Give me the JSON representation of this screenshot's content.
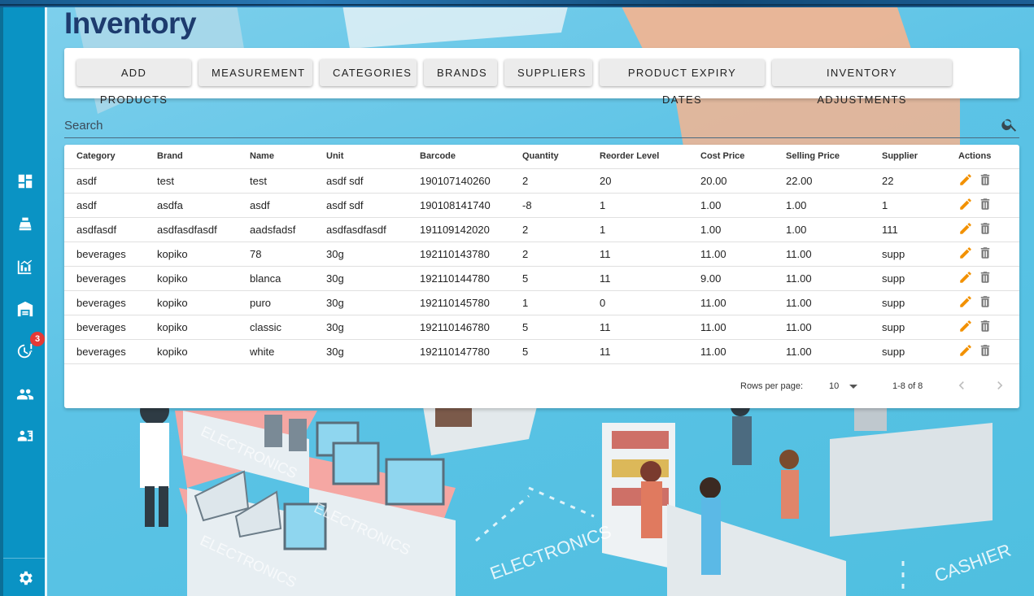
{
  "app": {
    "title": "Inventory"
  },
  "sidebar": {
    "items": [
      {
        "icon": "dashboard-icon"
      },
      {
        "icon": "cash-register-icon"
      },
      {
        "icon": "analytics-icon"
      },
      {
        "icon": "warehouse-icon"
      },
      {
        "icon": "clock-alert-icon",
        "badge": "3"
      },
      {
        "icon": "people-icon"
      },
      {
        "icon": "account-box-icon"
      }
    ],
    "footer_icon": "gear-icon"
  },
  "toolbar": {
    "buttons": [
      "ADD PRODUCTS",
      "MEASUREMENT",
      "CATEGORIES",
      "BRANDS",
      "SUPPLIERS",
      "PRODUCT EXPIRY DATES",
      "INVENTORY ADJUSTMENTS"
    ]
  },
  "search": {
    "placeholder": "Search",
    "value": ""
  },
  "table": {
    "columns": [
      "Category",
      "Brand",
      "Name",
      "Unit",
      "Barcode",
      "Quantity",
      "Reorder Level",
      "Cost Price",
      "Selling Price",
      "Supplier",
      "Actions"
    ],
    "rows": [
      [
        "asdf",
        "test",
        "test",
        "asdf sdf",
        "190107140260",
        "2",
        "20",
        "20.00",
        "22.00",
        "22"
      ],
      [
        "asdf",
        "asdfa",
        "asdf",
        "asdf sdf",
        "190108141740",
        "-8",
        "1",
        "1.00",
        "1.00",
        "1"
      ],
      [
        "asdfasdf",
        "asdfasdfasdf",
        "aadsfadsf",
        "asdfasdfasdf",
        "191109142020",
        "2",
        "1",
        "1.00",
        "1.00",
        "111"
      ],
      [
        "beverages",
        "kopiko",
        "78",
        "30g",
        "192110143780",
        "2",
        "11",
        "11.00",
        "11.00",
        "supp"
      ],
      [
        "beverages",
        "kopiko",
        "blanca",
        "30g",
        "192110144780",
        "5",
        "11",
        "9.00",
        "11.00",
        "supp"
      ],
      [
        "beverages",
        "kopiko",
        "puro",
        "30g",
        "192110145780",
        "1",
        "0",
        "11.00",
        "11.00",
        "supp"
      ],
      [
        "beverages",
        "kopiko",
        "classic",
        "30g",
        "192110146780",
        "5",
        "11",
        "11.00",
        "11.00",
        "supp"
      ],
      [
        "beverages",
        "kopiko",
        "white",
        "30g",
        "192110147780",
        "5",
        "11",
        "11.00",
        "11.00",
        "supp"
      ]
    ]
  },
  "pagination": {
    "rows_per_page_label": "Rows per page:",
    "rows_per_page": "10",
    "range": "1-8 of 8"
  },
  "colors": {
    "sidebar": "#0a93c4",
    "title": "#1d3b6e",
    "edit_icon": "#f29100",
    "delete_icon": "#757575",
    "badge": "#e53935"
  }
}
